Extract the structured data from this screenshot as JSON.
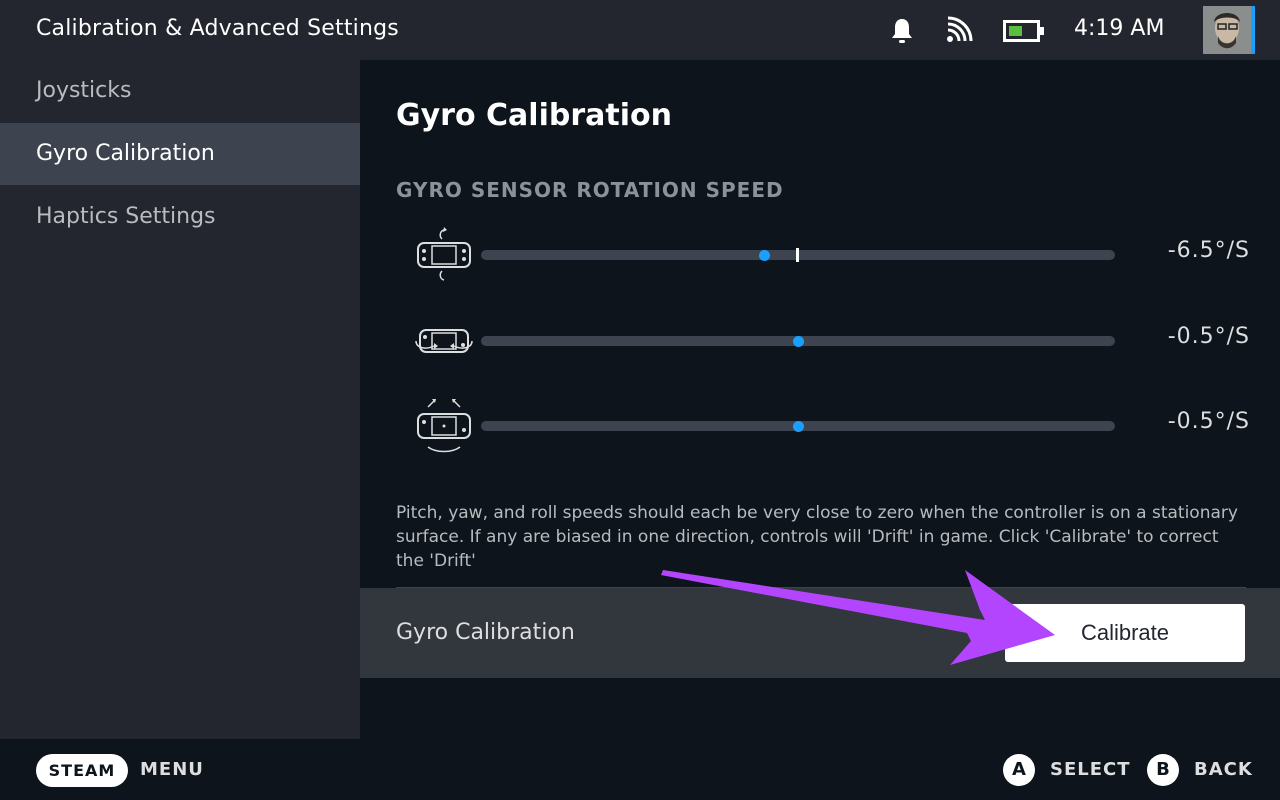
{
  "header": {
    "title": "Calibration & Advanced Settings",
    "time": "4:19 AM",
    "icons": [
      "bell-icon",
      "wifi-icon",
      "battery-icon",
      "avatar"
    ]
  },
  "sidebar": {
    "items": [
      {
        "label": "Joysticks",
        "active": false
      },
      {
        "label": "Gyro Calibration",
        "active": true
      },
      {
        "label": "Haptics Settings",
        "active": false
      }
    ]
  },
  "main": {
    "title": "Gyro Calibration",
    "section_label": "GYRO SENSOR ROTATION SPEED",
    "rows": [
      {
        "icon": "pitch-rotation-icon",
        "value": "-6.5°/S",
        "level": 0.447
      },
      {
        "icon": "yaw-rotation-icon",
        "value": "-0.5°/S",
        "level": 0.5
      },
      {
        "icon": "roll-rotation-icon",
        "value": "-0.5°/S",
        "level": 0.5
      }
    ],
    "description": "Pitch, yaw, and roll speeds should each be very close to zero when the controller is on a stationary surface. If any are biased in one direction, controls will 'Drift' in game. Click 'Calibrate' to correct the 'Drift'",
    "calibration_row": {
      "label": "Gyro Calibration",
      "button_label": "Calibrate"
    }
  },
  "footer": {
    "steam_label": "STEAM",
    "menu_label": "MENU",
    "select_glyph": "A",
    "select_label": "SELECT",
    "back_glyph": "B",
    "back_label": "BACK"
  },
  "colors": {
    "accent": "#1a9fff",
    "annotation_arrow": "#b445ff",
    "active_bg": "#3d4450"
  }
}
